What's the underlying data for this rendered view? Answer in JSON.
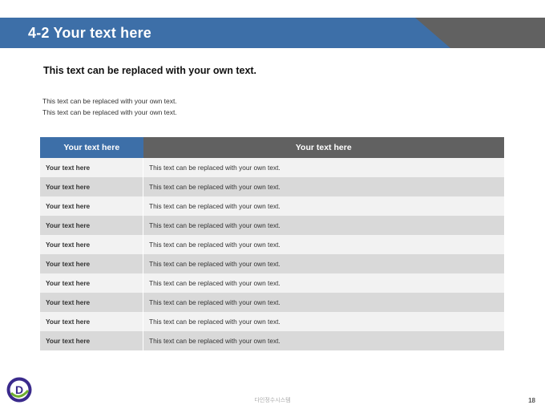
{
  "slide": {
    "title": "4-2 Your text here",
    "subtitle": "This text can be replaced with your own text.",
    "body_lines": [
      "This text can be replaced with your own text.",
      "This text can be replaced with your own text."
    ]
  },
  "table": {
    "headers": [
      "Your text here",
      "Your text here"
    ],
    "rows": [
      [
        "Your text here",
        "This text can be replaced with your own text."
      ],
      [
        "Your text here",
        "This text can be replaced with your own text."
      ],
      [
        "Your text here",
        "This text can be replaced with your own text."
      ],
      [
        "Your text here",
        "This text can be replaced with your own text."
      ],
      [
        "Your text here",
        "This text can be replaced with your own text."
      ],
      [
        "Your text here",
        "This text can be replaced with your own text."
      ],
      [
        "Your text here",
        "This text can be replaced with your own text."
      ],
      [
        "Your text here",
        "This text can be replaced with your own text."
      ],
      [
        "Your text here",
        "This text can be replaced with your own text."
      ],
      [
        "Your text here",
        "This text can be replaced with your own text."
      ]
    ]
  },
  "footer": {
    "logo_letter": "D",
    "company": "다인정수시스템",
    "page_number": "18"
  },
  "colors": {
    "header_blue": "#3d6fa8",
    "header_gray": "#616161",
    "logo_purple": "#3a2a8c",
    "logo_green": "#6fae2e"
  }
}
